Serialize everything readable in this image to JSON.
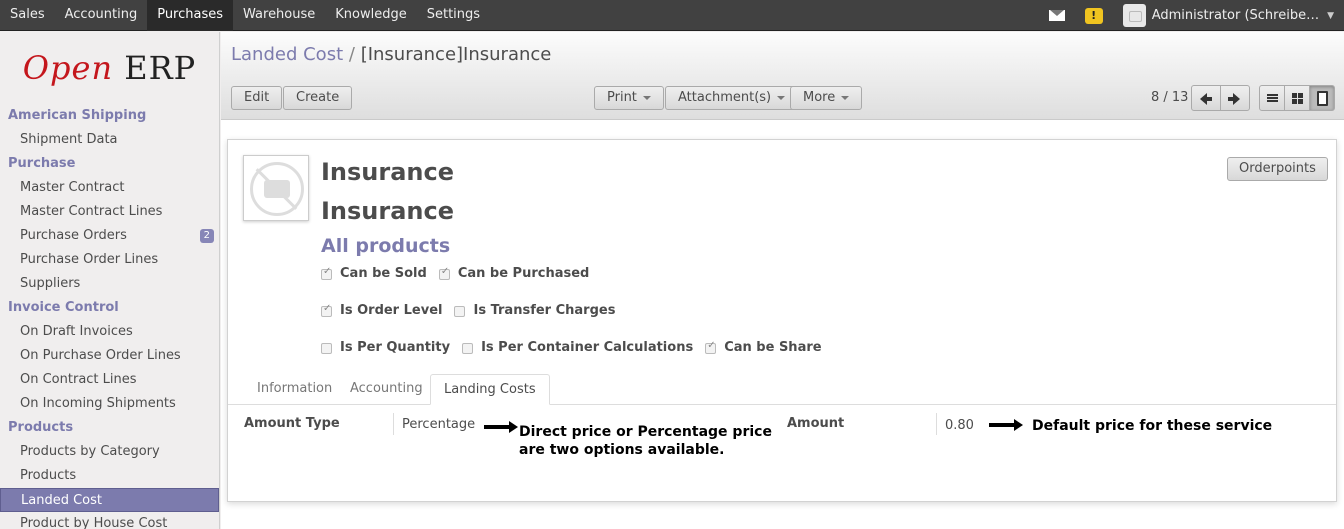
{
  "topmenu": [
    "Sales",
    "Accounting",
    "Purchases",
    "Warehouse",
    "Knowledge",
    "Settings"
  ],
  "user": {
    "name": "Administrator (Schreibe…"
  },
  "logo": {
    "open": "Open",
    "erp": "ERP"
  },
  "sidebar": {
    "sections": [
      {
        "title": "American Shipping",
        "items": [
          {
            "label": "Shipment Data"
          }
        ]
      },
      {
        "title": "Purchase",
        "items": [
          {
            "label": "Master Contract"
          },
          {
            "label": "Master Contract Lines"
          },
          {
            "label": "Purchase Orders",
            "badge": "2"
          },
          {
            "label": "Purchase Order Lines"
          },
          {
            "label": "Suppliers"
          }
        ]
      },
      {
        "title": "Invoice Control",
        "items": [
          {
            "label": "On Draft Invoices"
          },
          {
            "label": "On Purchase Order Lines"
          },
          {
            "label": "On Contract Lines"
          },
          {
            "label": "On Incoming Shipments"
          }
        ]
      },
      {
        "title": "Products",
        "items": [
          {
            "label": "Products by Category"
          },
          {
            "label": "Products"
          },
          {
            "label": "Landed Cost"
          },
          {
            "label": "Product by House Cost"
          }
        ]
      }
    ]
  },
  "breadcrumb": {
    "parent": "Landed Cost",
    "sep": "/",
    "current": "[Insurance]Insurance"
  },
  "buttons": {
    "edit": "Edit",
    "create": "Create",
    "print": "Print",
    "attachments": "Attachment(s)",
    "more": "More"
  },
  "pager": {
    "text": "8 / 13"
  },
  "form": {
    "name": "Insurance",
    "default_code_name": "Insurance",
    "category": "All products",
    "orderpoints": "Orderpoints",
    "checkboxes": {
      "can_be_sold": {
        "label": "Can be Sold",
        "checked": true
      },
      "can_be_purchased": {
        "label": "Can be Purchased",
        "checked": true
      },
      "is_order_level": {
        "label": "Is Order Level",
        "checked": true
      },
      "is_transfer_charges": {
        "label": "Is Transfer Charges",
        "checked": false
      },
      "is_per_quantity": {
        "label": "Is Per Quantity",
        "checked": false
      },
      "is_per_container": {
        "label": "Is Per Container Calculations",
        "checked": false
      },
      "can_be_share": {
        "label": "Can be Share",
        "checked": true
      }
    },
    "tabs": [
      "Information",
      "Accounting",
      "Landing Costs"
    ],
    "amount_type_label": "Amount Type",
    "amount_type_value": "Percentage",
    "amount_label": "Amount",
    "amount_value": "0.80",
    "annotation1": "Direct price or Percentage price are two options available.",
    "annotation2": "Default price for these service"
  },
  "colors": {
    "accent": "#7c7bad",
    "topbar": "#414141"
  }
}
